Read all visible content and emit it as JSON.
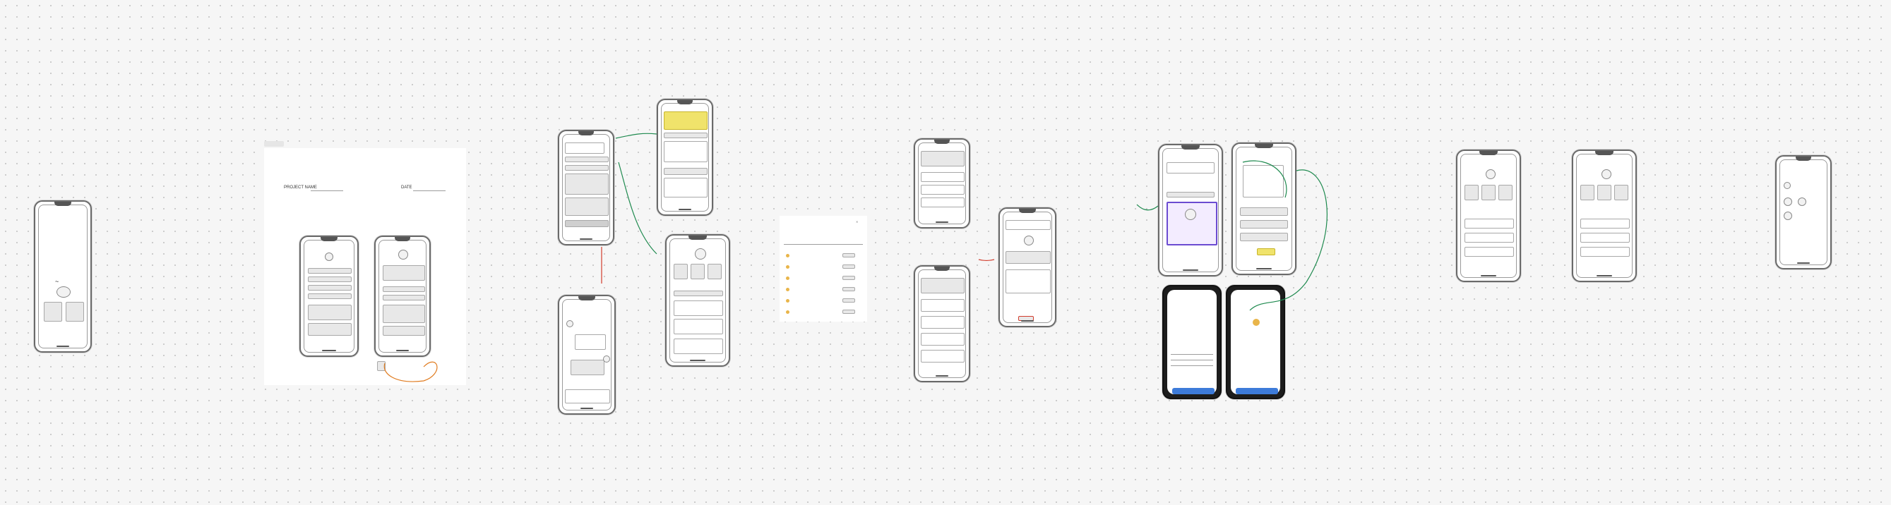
{
  "board": {
    "title": "",
    "colors": {
      "background": "#f6f6f6",
      "sketch_green": "#1f8a4f",
      "sketch_orange": "#e07b1f",
      "sketch_red": "#d23c2c",
      "accent_blue": "#3d7bd9"
    }
  },
  "labels": {
    "project_name": "PROJECT NAME",
    "date": "DATE",
    "caption_flow": "",
    "frame_label_a": "",
    "frame_label_b": ""
  },
  "list_panel": {
    "header": "",
    "sub": "",
    "rows": [
      "",
      "",
      "",
      "",
      "",
      ""
    ],
    "tags": [
      "",
      "",
      "",
      "",
      "",
      ""
    ]
  },
  "dark_phones": {
    "left_title": "",
    "right_title": "",
    "button_left": "",
    "button_right": ""
  },
  "icons": [
    "arrow-icon",
    "close-icon",
    "heart-icon"
  ]
}
